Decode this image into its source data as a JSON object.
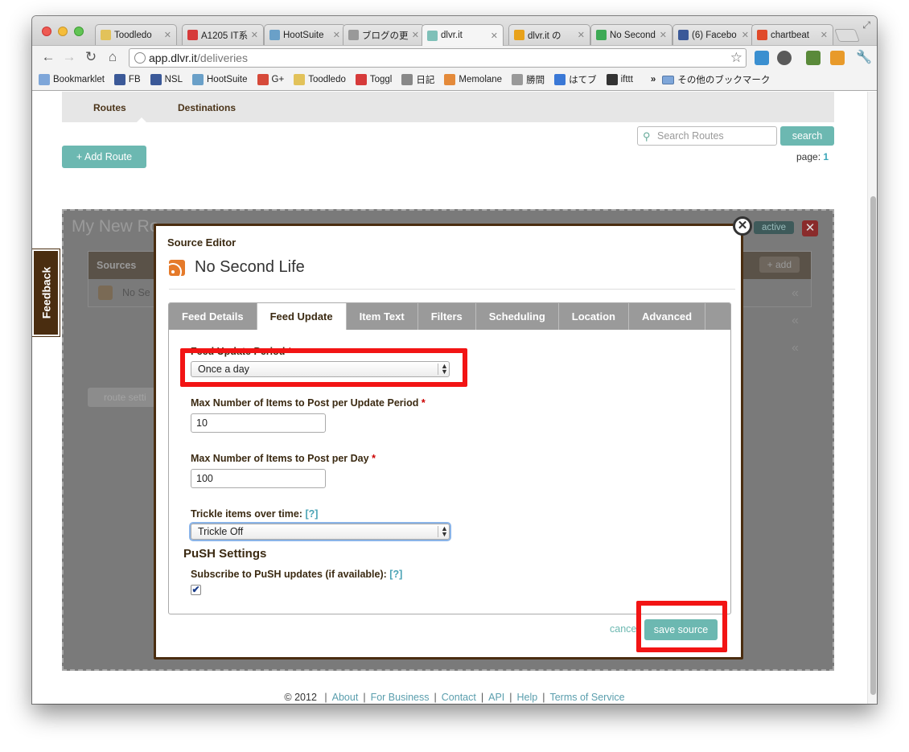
{
  "browser": {
    "tabs": [
      {
        "label": "Toodledo",
        "color": "#e2c25a",
        "active": false
      },
      {
        "label": "A1205 IT系",
        "color": "#d63a3a",
        "active": false
      },
      {
        "label": "HootSuite",
        "color": "#6aa0c8",
        "active": false
      },
      {
        "label": "ブログの更",
        "color": "#999999",
        "active": false
      },
      {
        "label": "dlvr.it",
        "color": "#7ec0b8",
        "active": true
      },
      {
        "label": "dlvr.it の",
        "color": "#e8a21b",
        "active": false
      },
      {
        "label": "No Second",
        "color": "#3daa55",
        "active": false
      },
      {
        "label": "(6) Facebo",
        "color": "#3b5998",
        "active": false
      },
      {
        "label": "chartbeat",
        "color": "#e04a2a",
        "active": false
      }
    ],
    "url_host": "app.dlvr.it",
    "url_path": "/deliveries",
    "bookmarks": [
      {
        "label": "Bookmarklet",
        "color": "#7ea6d9"
      },
      {
        "label": "FB",
        "color": "#3b5998"
      },
      {
        "label": "NSL",
        "color": "#3b5998"
      },
      {
        "label": "HootSuite",
        "color": "#6aa0c8"
      },
      {
        "label": "G+",
        "color": "#d64a3a"
      },
      {
        "label": "Toodledo",
        "color": "#e2c25a"
      },
      {
        "label": "Toggl",
        "color": "#d63a3a"
      },
      {
        "label": "日記",
        "color": "#888888"
      },
      {
        "label": "Memolane",
        "color": "#e48a3a"
      },
      {
        "label": "勝間",
        "color": "#999999"
      },
      {
        "label": "はてブ",
        "color": "#3a78d6"
      },
      {
        "label": "ifttt",
        "color": "#333333"
      }
    ],
    "bookmarks_more": "»",
    "other_bookmarks": "その他のブックマーク"
  },
  "page": {
    "subnav": {
      "routes": "Routes",
      "destinations": "Destinations"
    },
    "search_placeholder": "Search Routes",
    "search_button": "search",
    "add_route": "+ Add Route",
    "page_label": "page:",
    "page_number": "1",
    "route_title": "My New Ro",
    "active_badge": "active",
    "sources_label": "Sources",
    "add_label": "+ add",
    "source_row": "No Se",
    "route_settings": "route setti",
    "feedback": "Feedback",
    "footer": {
      "copyright": "© 2012",
      "links": [
        "About",
        "For Business",
        "Contact",
        "API",
        "Help",
        "Terms of Service"
      ]
    }
  },
  "modal": {
    "label": "Source Editor",
    "title": "No Second Life",
    "tabs": [
      "Feed Details",
      "Feed Update",
      "Item Text",
      "Filters",
      "Scheduling",
      "Location",
      "Advanced"
    ],
    "active_tab": "Feed Update",
    "fields": {
      "period_label": "Feed Update Period",
      "period_value": "Once a day",
      "max_period_label": "Max Number of Items to Post per Update Period",
      "max_period_value": "10",
      "max_day_label": "Max Number of Items to Post per Day",
      "max_day_value": "100",
      "trickle_label": "Trickle items over time:",
      "trickle_help": "[?]",
      "trickle_value": "Trickle Off",
      "push_heading": "PuSH Settings",
      "push_label": "Subscribe to PuSH updates (if available):",
      "push_help": "[?]",
      "push_checked": true,
      "required_mark": "*"
    },
    "cancel": "cancel",
    "save": "save source"
  },
  "colors": {
    "accent": "#6cb8b1",
    "brand_brown": "#4a2d10",
    "highlight_red": "#f21414"
  }
}
